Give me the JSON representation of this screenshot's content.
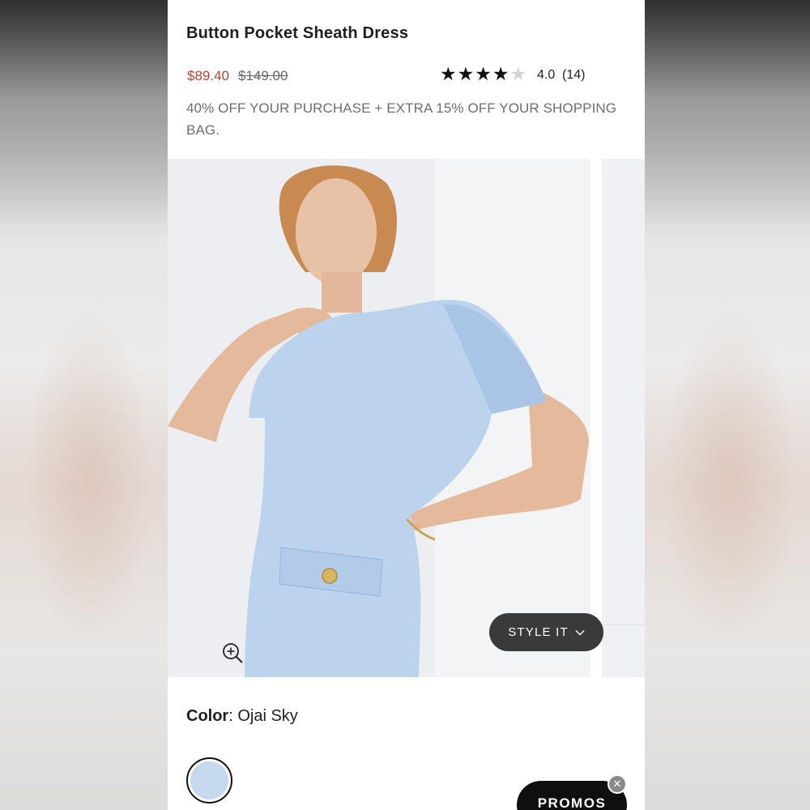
{
  "product": {
    "title": "Button Pocket Sheath Dress",
    "sale_price": "$89.40",
    "original_price": "$149.00",
    "rating": {
      "stars_filled": 4,
      "stars_total": 5,
      "value": "4.0",
      "count": "(14)"
    },
    "promo_message": "40% OFF YOUR PURCHASE + EXTRA 15% OFF YOUR SHOPPING BAG."
  },
  "gallery": {
    "zoom_icon": "zoom-in-icon",
    "style_it_label": "STYLE IT",
    "style_it_icon": "chevron-down-icon"
  },
  "color": {
    "label": "Color",
    "value": "Ojai Sky",
    "swatch_color": "#c5d8ee"
  },
  "promos": {
    "label": "PROMOS",
    "close_icon": "close-icon"
  },
  "colors": {
    "sale_price": "#b0443c",
    "style_it_bg": "#3a3a3a",
    "promos_bg": "#0f0f0f"
  }
}
